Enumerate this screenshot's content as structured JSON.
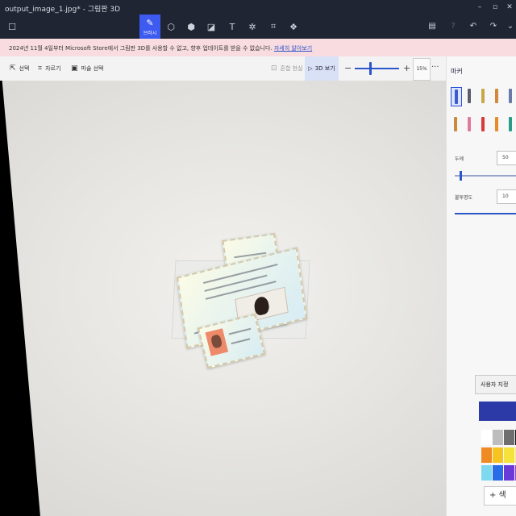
{
  "window": {
    "title": "output_image_1.jpg* - 그림판 3D",
    "controls": [
      "minimize-icon",
      "maximize-icon",
      "close-icon"
    ]
  },
  "toolbar": {
    "tools": [
      {
        "icon": "brush-icon",
        "label": "브러시",
        "active": true
      },
      {
        "icon": "2d-shapes-icon",
        "label": "",
        "active": false
      },
      {
        "icon": "3d-shapes-icon",
        "label": "",
        "active": false
      },
      {
        "icon": "stickers-icon",
        "label": "",
        "active": false
      },
      {
        "icon": "text-icon",
        "label": "",
        "active": false
      },
      {
        "icon": "effects-icon",
        "label": "",
        "active": false
      },
      {
        "icon": "canvas-icon",
        "label": "",
        "active": false
      },
      {
        "icon": "3d-library-icon",
        "label": "",
        "active": false
      }
    ],
    "right": [
      "paste-icon",
      "help-icon",
      "undo-icon",
      "redo-icon",
      "more-down-icon"
    ]
  },
  "banner": {
    "message": "2024년 11월 4일부터 Microsoft Store에서 그림판 3D를 사용할 수 없고, 향후 업데이트를 받을 수 없습니다.",
    "link": "자세히 알아보기"
  },
  "subtoolbar": {
    "select": "선택",
    "crop": "자르기",
    "magic_select": "마술 선택",
    "mixed_reality": "혼합 현실",
    "view_3d": "3D 보기",
    "zoom": "15%",
    "more": "···"
  },
  "panel": {
    "title": "마커",
    "thickness_label": "두께",
    "thickness_value": "50",
    "opacity_label": "불투명도",
    "opacity_value": "10",
    "custom_button": "사용자 지정",
    "add_label": "+ 색",
    "selected_color": "#2b3aa6",
    "brushes": [
      {
        "icon": "marker-icon",
        "color": "#3b5bd4",
        "selected": true
      },
      {
        "icon": "calligraphy-pen-icon",
        "color": "#5a5f6a"
      },
      {
        "icon": "oil-brush-icon",
        "color": "#c9a64a"
      },
      {
        "icon": "watercolor-icon",
        "color": "#d28a3a"
      },
      {
        "icon": "pixel-pen-icon",
        "color": "#6a7aa8"
      },
      {
        "icon": "pencil-icon",
        "color": "#c98a3a"
      },
      {
        "icon": "eraser-icon",
        "color": "#e07a9a"
      },
      {
        "icon": "crayon-icon",
        "color": "#d63a3a"
      },
      {
        "icon": "spray-can-icon",
        "color": "#e88a2a"
      },
      {
        "icon": "fill-icon",
        "color": "#2a9a8a"
      }
    ],
    "palette": [
      "#ffffff",
      "#bdbdbd",
      "#6e6e6e",
      "#111111",
      "#f08a24",
      "#f7c31e",
      "#f5e23a",
      "#f7ef6e",
      "#7ed8f0",
      "#2a6ce8",
      "#6a3ad8",
      "#9a3ad8"
    ]
  }
}
